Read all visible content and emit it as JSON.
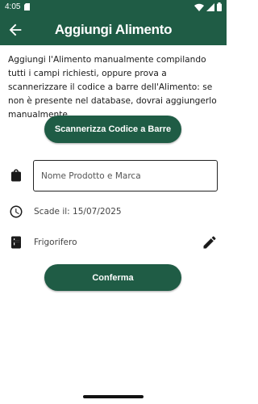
{
  "status_bar": {
    "time": "4:05",
    "icons": [
      "sd-card-icon",
      "wifi-icon",
      "signal-icon",
      "battery-icon"
    ]
  },
  "app_bar": {
    "title": "Aggiungi Alimento",
    "back_icon": "arrow-back-icon"
  },
  "intro_text": "Aggiungi l'Alimento manualmente compilando tutti i campi richiesti, oppure prova a scannerizzare il codice a barre dell'Alimento: se non è presente nel database, dovrai aggiungerlo manualmente.",
  "scan_button_label": "Scannerizza Codice a Barre",
  "product_field": {
    "placeholder": "Nome Prodotto e Marca",
    "value": "",
    "icon": "shopping-bag-icon"
  },
  "expiry": {
    "label": "Scade il: 15/07/2025",
    "icon": "clock-icon"
  },
  "storage": {
    "label": "Frigorifero",
    "icon": "fridge-icon",
    "edit_icon": "pencil-icon"
  },
  "confirm_button_label": "Conferma",
  "colors": {
    "primary": "#1f5c45",
    "on_primary": "#ffffff",
    "text": "#1a1a1a",
    "secondary_text": "#444444"
  }
}
